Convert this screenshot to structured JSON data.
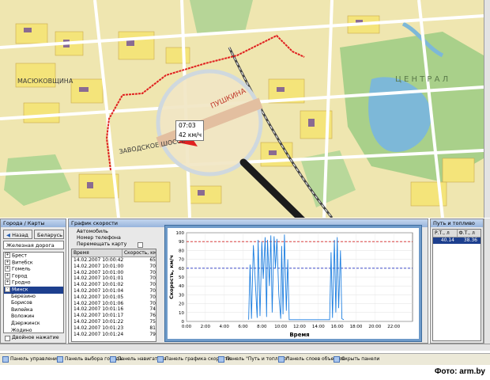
{
  "map": {
    "labels": [
      "МАСЮКОВЩИНА",
      "ЗАВОДСКОЕ ШОССЕ",
      "Ц Е Н Т Р А Л",
      "ПУШКИНА"
    ],
    "popup": {
      "time": "07:03",
      "speed": "42 км/ч"
    }
  },
  "cities_panel": {
    "title": "Города / Карты",
    "back_label": "Назад",
    "country_label": "Беларусь",
    "rail_label": "Железная дорога",
    "tree_items": [
      {
        "label": "Брест",
        "toggle": "+",
        "indent": 0,
        "selected": false
      },
      {
        "label": "Витебск",
        "toggle": "+",
        "indent": 0,
        "selected": false
      },
      {
        "label": "Гомель",
        "toggle": "+",
        "indent": 0,
        "selected": false
      },
      {
        "label": "Город",
        "toggle": "+",
        "indent": 0,
        "selected": false
      },
      {
        "label": "Гродно",
        "toggle": "+",
        "indent": 0,
        "selected": false
      },
      {
        "label": "Минск",
        "toggle": "-",
        "indent": 0,
        "selected": true
      },
      {
        "label": "Березино",
        "toggle": "",
        "indent": 1,
        "selected": false
      },
      {
        "label": "Борисов",
        "toggle": "",
        "indent": 1,
        "selected": false
      },
      {
        "label": "Вилейка",
        "toggle": "",
        "indent": 1,
        "selected": false
      },
      {
        "label": "Воложин",
        "toggle": "",
        "indent": 1,
        "selected": false
      },
      {
        "label": "Дзержинск",
        "toggle": "",
        "indent": 1,
        "selected": false
      },
      {
        "label": "Жодино",
        "toggle": "",
        "indent": 1,
        "selected": false
      }
    ],
    "double_click_label": "Двойное нажатие"
  },
  "speed_panel": {
    "title": "График скорости",
    "car_label": "Автомобиль",
    "phone_label": "Номер телефона",
    "move_map_label": "Перемещать карту",
    "columns": [
      "Время",
      "Скорость, км/ч"
    ],
    "rows": [
      [
        "14.02.2007 10:00:42",
        "65"
      ],
      [
        "14.02.2007 10:01:00",
        "70"
      ],
      [
        "14.02.2007 10:01:00",
        "70"
      ],
      [
        "14.02.2007 10:01:01",
        "70"
      ],
      [
        "14.02.2007 10:01:02",
        "70"
      ],
      [
        "14.02.2007 10:01:04",
        "70"
      ],
      [
        "14.02.2007 10:01:05",
        "70"
      ],
      [
        "14.02.2007 10:01:06",
        "70"
      ],
      [
        "14.02.2007 10:01:16",
        "74"
      ],
      [
        "14.02.2007 10:01:17",
        "76"
      ],
      [
        "14.02.2007 10:01:22",
        "75"
      ],
      [
        "14.02.2007 10:01:23",
        "81"
      ],
      [
        "14.02.2007 10:01:24",
        "79"
      ]
    ]
  },
  "right_panel": {
    "title": "Путь и топливо",
    "columns": [
      "Р.Т., л",
      "Ф.Т., л"
    ],
    "values": [
      "40.14",
      "38.36"
    ]
  },
  "chart_data": {
    "type": "line",
    "xlabel": "Время",
    "ylabel": "Скорость, км/ч",
    "xlim": [
      0,
      24
    ],
    "ylim": [
      0,
      100
    ],
    "x_ticks": [
      "0:00",
      "2:00",
      "4:00",
      "6:00",
      "8:00",
      "10:00",
      "12:00",
      "14:00",
      "16:00",
      "18:00",
      "20:00",
      "22:00"
    ],
    "y_ticks": [
      0,
      10,
      20,
      30,
      40,
      50,
      60,
      70,
      80,
      90,
      100
    ],
    "ref_lines": [
      {
        "y": 90,
        "color": "#d42020"
      },
      {
        "y": 60,
        "color": "#2030c0"
      }
    ],
    "series": [
      {
        "color": "#1e7fe0",
        "x": [
          6.6,
          6.75,
          6.9,
          7.1,
          7.3,
          7.5,
          7.6,
          7.8,
          8.0,
          8.15,
          8.35,
          8.5,
          8.6,
          8.8,
          8.95,
          9.1,
          9.3,
          9.45,
          9.6,
          9.8,
          10.0,
          10.1,
          10.25,
          10.4,
          10.6,
          10.75,
          10.9,
          15.2,
          15.35,
          15.5,
          15.7,
          15.85,
          16.0,
          16.15,
          16.35,
          16.5,
          16.7
        ],
        "y": [
          2,
          64,
          3,
          86,
          45,
          4,
          92,
          6,
          90,
          48,
          95,
          5,
          92,
          40,
          97,
          10,
          96,
          60,
          93,
          30,
          3,
          85,
          8,
          98,
          12,
          70,
          2,
          2,
          78,
          4,
          92,
          10,
          95,
          15,
          80,
          3,
          2
        ]
      }
    ]
  },
  "statusbar": {
    "items": [
      "Панель управления",
      "Панель выбора города",
      "Панель навигатора",
      "Панель графика скорости",
      "Панель \"Путь и топливо\"",
      "Панель слоев объектов",
      "Скрыть панели"
    ]
  },
  "credit": "Фото: arm.by"
}
